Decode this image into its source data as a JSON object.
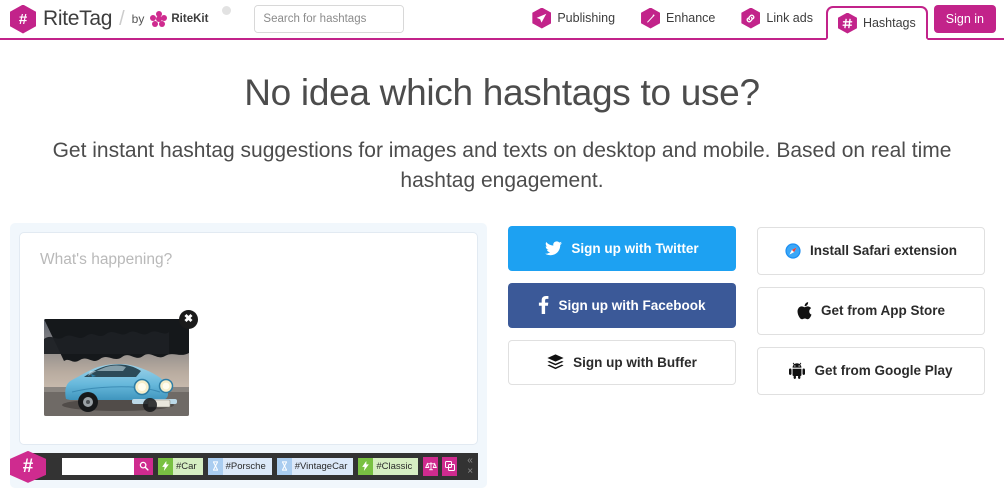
{
  "header": {
    "brand_name": "RiteTag",
    "brand_separator": "/",
    "brand_by": "by",
    "parent_brand": "RiteKit",
    "logo_glyph": "#",
    "search": {
      "placeholder": "Search for hashtags",
      "value": "",
      "button_icon": "search-icon"
    },
    "nav": [
      {
        "label": "Publishing",
        "icon": "paper-plane-icon",
        "active": false
      },
      {
        "label": "Enhance",
        "icon": "magic-wand-icon",
        "active": false
      },
      {
        "label": "Link ads",
        "icon": "link-icon",
        "active": false
      },
      {
        "label": "Hashtags",
        "icon": "hashtag-icon",
        "active": true
      }
    ],
    "signin_label": "Sign in",
    "accent_color": "#c2238a"
  },
  "hero": {
    "headline": "No idea which hashtags to use?",
    "subhead": "Get instant hashtag suggestions for images and texts on desktop and mobile. Based on real time hashtag engagement."
  },
  "demo": {
    "compose_placeholder": "What's happening?",
    "attachment_alt": "Light blue vintage Porsche 911 parked in front of dark trees at dusk",
    "remove_attachment_label": "✖",
    "toolbar": {
      "logo_glyph": "#",
      "search_value": "",
      "search_button_icon": "search-icon",
      "chips": [
        {
          "label": "#Car",
          "type": "green",
          "icon": "lightning-bolt-icon"
        },
        {
          "label": "#Porsche",
          "type": "blue",
          "icon": "hourglass-icon"
        },
        {
          "label": "#VintageCar",
          "type": "blue",
          "icon": "hourglass-icon"
        },
        {
          "label": "#Classic",
          "type": "green",
          "icon": "lightning-bolt-icon"
        }
      ],
      "tools": [
        {
          "icon": "balance-scale-icon"
        },
        {
          "icon": "shuffle-tags-icon"
        }
      ],
      "collapse_label": "« ×"
    }
  },
  "signup": {
    "buttons": [
      {
        "label": "Sign up with Twitter",
        "icon": "twitter-icon",
        "style": "twitter"
      },
      {
        "label": "Sign up with Facebook",
        "icon": "facebook-icon",
        "style": "facebook"
      },
      {
        "label": "Sign up with Buffer",
        "icon": "buffer-icon",
        "style": "plain"
      }
    ]
  },
  "apps": {
    "buttons": [
      {
        "label": "Install Safari extension",
        "icon": "safari-icon"
      },
      {
        "label": "Get from App Store",
        "icon": "apple-icon"
      },
      {
        "label": "Get from Google Play",
        "icon": "android-icon"
      }
    ]
  }
}
